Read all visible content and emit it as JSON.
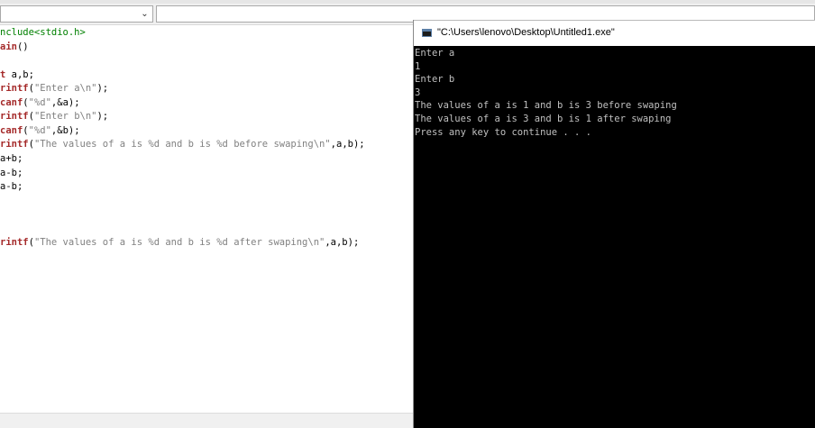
{
  "toolbar": {
    "left_combo_value": "",
    "right_combo_value": "",
    "combo_arrow": "chevron-down-icon"
  },
  "editor": {
    "lines": [
      {
        "parts": [
          {
            "t": "nclude<stdio.h>",
            "c": "pp"
          }
        ]
      },
      {
        "parts": [
          {
            "t": "ain",
            "c": "kw"
          },
          {
            "t": "()",
            "c": "punc"
          }
        ]
      },
      {
        "parts": []
      },
      {
        "parts": [
          {
            "t": "t",
            "c": "kw"
          },
          {
            "t": " a,b;",
            "c": "punc"
          }
        ]
      },
      {
        "parts": [
          {
            "t": "rintf",
            "c": "kw"
          },
          {
            "t": "(",
            "c": "punc"
          },
          {
            "t": "\"Enter a\\n\"",
            "c": "str"
          },
          {
            "t": ");",
            "c": "punc"
          }
        ]
      },
      {
        "parts": [
          {
            "t": "canf",
            "c": "kw"
          },
          {
            "t": "(",
            "c": "punc"
          },
          {
            "t": "\"%d\"",
            "c": "str"
          },
          {
            "t": ",&a);",
            "c": "punc"
          }
        ]
      },
      {
        "parts": [
          {
            "t": "rintf",
            "c": "kw"
          },
          {
            "t": "(",
            "c": "punc"
          },
          {
            "t": "\"Enter b\\n\"",
            "c": "str"
          },
          {
            "t": ");",
            "c": "punc"
          }
        ]
      },
      {
        "parts": [
          {
            "t": "canf",
            "c": "kw"
          },
          {
            "t": "(",
            "c": "punc"
          },
          {
            "t": "\"%d\"",
            "c": "str"
          },
          {
            "t": ",&b);",
            "c": "punc"
          }
        ]
      },
      {
        "parts": [
          {
            "t": "rintf",
            "c": "kw"
          },
          {
            "t": "(",
            "c": "punc"
          },
          {
            "t": "\"The values of a is %d and b is %d before swaping\\n\"",
            "c": "str"
          },
          {
            "t": ",a,b);",
            "c": "punc"
          }
        ]
      },
      {
        "parts": [
          {
            "t": "a+b;",
            "c": "punc"
          }
        ]
      },
      {
        "parts": [
          {
            "t": "a-b;",
            "c": "punc"
          }
        ]
      },
      {
        "parts": [
          {
            "t": "a-b;",
            "c": "punc"
          }
        ]
      },
      {
        "parts": []
      },
      {
        "parts": []
      },
      {
        "parts": []
      },
      {
        "parts": [
          {
            "t": "rintf",
            "c": "kw"
          },
          {
            "t": "(",
            "c": "punc"
          },
          {
            "t": "\"The values of a is %d and b is %d after swaping\\n\"",
            "c": "str"
          },
          {
            "t": ",a,b);",
            "c": "punc"
          }
        ]
      }
    ]
  },
  "console": {
    "title": "\"C:\\Users\\lenovo\\Desktop\\Untitled1.exe\"",
    "icon": "console-window-icon",
    "lines": [
      "Enter a",
      "1",
      "Enter b",
      "3",
      "The values of a is 1 and b is 3 before swaping",
      "The values of a is 3 and b is 1 after swaping",
      "Press any key to continue . . ."
    ]
  }
}
